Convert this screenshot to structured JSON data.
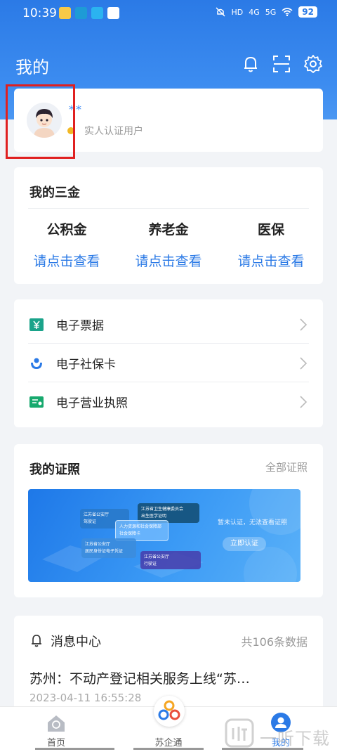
{
  "status_bar": {
    "time": "10:39",
    "battery": "92",
    "indicators": [
      "HD",
      "4G",
      "5G"
    ]
  },
  "header": {
    "title": "我的"
  },
  "profile": {
    "name": "**",
    "verify_label": "实人认证用户"
  },
  "funds": {
    "title": "我的三金",
    "items": [
      {
        "name": "公积金",
        "action": "请点击查看"
      },
      {
        "name": "养老金",
        "action": "请点击查看"
      },
      {
        "name": "医保",
        "action": "请点击查看"
      }
    ]
  },
  "services": [
    {
      "label": "电子票据",
      "icon": "receipt-icon"
    },
    {
      "label": "电子社保卡",
      "icon": "social-card-icon"
    },
    {
      "label": "电子营业执照",
      "icon": "license-icon"
    }
  ],
  "certificates": {
    "title": "我的证照",
    "view_all": "全部证照",
    "banner": {
      "prompt": "暂未认证，无法查看证照",
      "button": "立即认证",
      "cards": [
        {
          "org": "江苏省公安厅",
          "name": "驾驶证"
        },
        {
          "org": "江苏省卫生健康委员会",
          "name": "出生医学证明"
        },
        {
          "org": "人力资源和社会保障部",
          "name": "社会保障卡"
        },
        {
          "org": "江苏省公安厅",
          "name": "居民身份证电子凭证"
        },
        {
          "org": "江苏省公安厅",
          "name": "行驶证"
        }
      ]
    }
  },
  "messages": {
    "title": "消息中心",
    "count": "共106条数据",
    "latest_text": "苏州：不动产登记相关服务上线“苏…",
    "latest_time": "2023-04-11 16:55:28"
  },
  "bottom_nav": [
    {
      "label": "首页",
      "active": false
    },
    {
      "label": "苏企通",
      "active": false
    },
    {
      "label": "我的",
      "active": true
    }
  ],
  "watermark": "一听下载",
  "colors": {
    "primary": "#2b7ae6",
    "highlight_box": "#e02020",
    "verify_badge": "#f2b824"
  }
}
